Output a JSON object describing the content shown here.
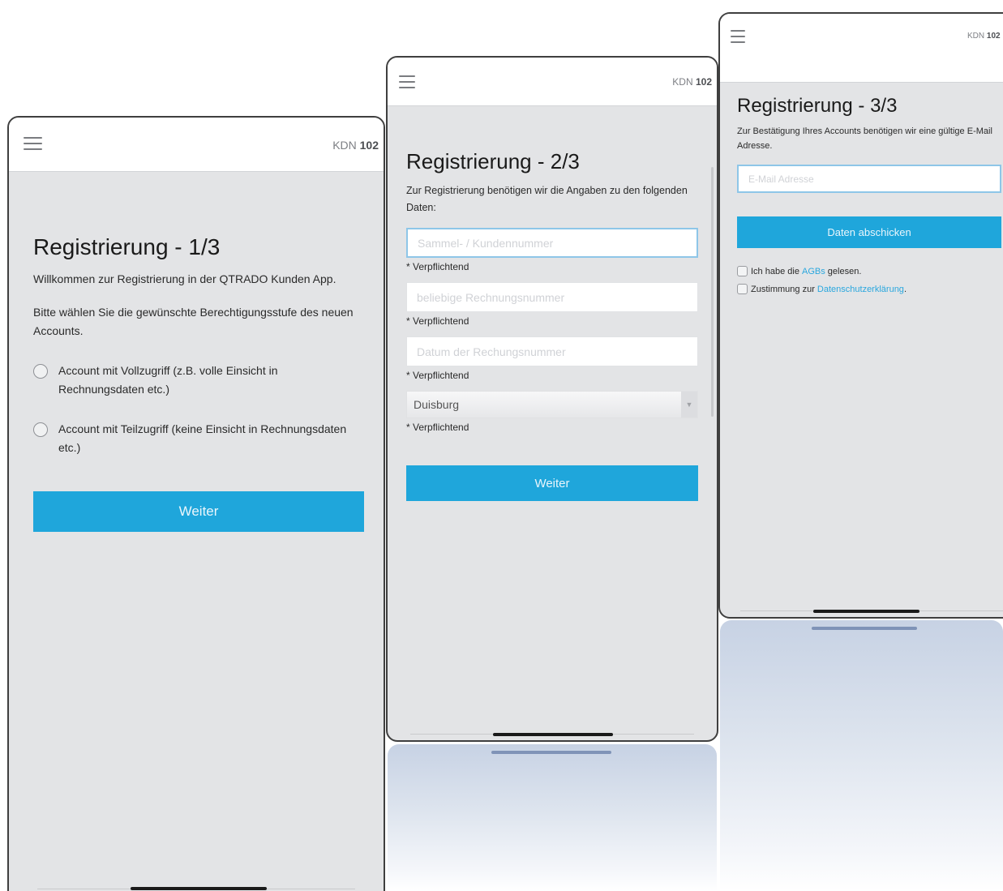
{
  "screen1": {
    "kdn_label": "KDN",
    "kdn_number": "102",
    "title": "Registrierung - 1/3",
    "welcome": "Willkommen zur Registrierung in der QTRADO Kunden App.",
    "instruction": "Bitte wählen Sie die gewünschte Berechtigungsstufe des neuen Accounts.",
    "options": [
      "Account mit Vollzugriff (z.B. volle Einsicht in Rechnungsdaten etc.)",
      "Account mit Teilzugriff (keine Einsicht in Rechnungsdaten etc.)"
    ],
    "button": "Weiter"
  },
  "screen2": {
    "kdn_label": "KDN",
    "kdn_number": "102",
    "title": "Registrierung - 2/3",
    "intro": "Zur Registrierung benötigen wir die Angaben zu den folgenden Daten:",
    "fields": [
      {
        "placeholder": "Sammel- / Kundennummer",
        "hint": "* Verpflichtend"
      },
      {
        "placeholder": "beliebige Rechnungsnummer",
        "hint": "* Verpflichtend"
      },
      {
        "placeholder": "Datum der Rechungsnummer",
        "hint": "* Verpflichtend"
      }
    ],
    "select": {
      "value": "Duisburg",
      "hint": "* Verpflichtend"
    },
    "button": "Weiter"
  },
  "screen3": {
    "kdn_label": "KDN",
    "kdn_number": "102",
    "title": "Registrierung - 3/3",
    "intro": "Zur Bestätigung Ihres Accounts benötigen wir eine gültige E-Mail Adresse.",
    "email_placeholder": "E-Mail Adresse",
    "button": "Daten abschicken",
    "agb": {
      "pre": "Ich habe die",
      "link": "AGBs",
      "post": "gelesen."
    },
    "privacy": {
      "pre": "Zustimmung zur",
      "link": "Datenschutzerklärung",
      "post": "."
    }
  }
}
